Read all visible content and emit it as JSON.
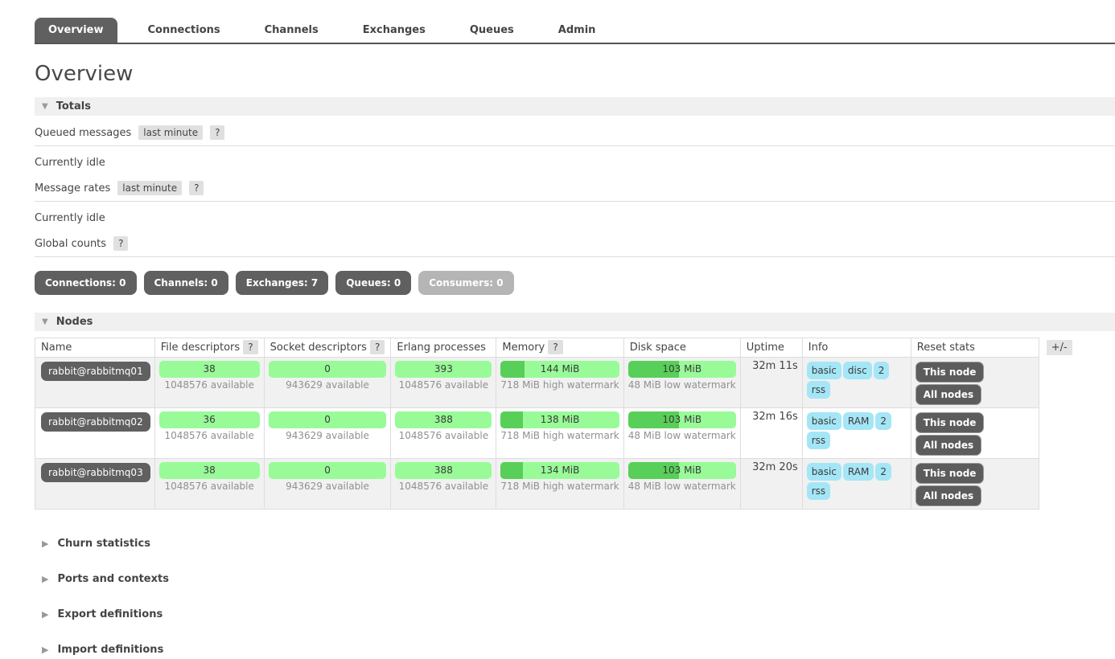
{
  "colors": {
    "accent_dark": "#606060",
    "disabled_gray": "#b5b5b5",
    "bar_light_green": "#98fb98",
    "bar_dark_green": "#58cf58",
    "info_badge_blue": "#a5e6f6",
    "strip_gray": "#f0f0f0"
  },
  "nav": {
    "tabs": [
      {
        "label": "Overview",
        "active": true
      },
      {
        "label": "Connections",
        "active": false
      },
      {
        "label": "Channels",
        "active": false
      },
      {
        "label": "Exchanges",
        "active": false
      },
      {
        "label": "Queues",
        "active": false
      },
      {
        "label": "Admin",
        "active": false
      }
    ]
  },
  "page_title": "Overview",
  "totals": {
    "section_label": "Totals",
    "queued": {
      "label": "Queued messages",
      "mode": "last minute",
      "help": "?",
      "status": "Currently idle"
    },
    "message_rates": {
      "label": "Message rates",
      "mode": "last minute",
      "help": "?",
      "status": "Currently idle"
    },
    "global_counts": {
      "label": "Global counts",
      "help": "?"
    },
    "counts": [
      {
        "label": "Connections: 0",
        "disabled": false
      },
      {
        "label": "Channels: 0",
        "disabled": false
      },
      {
        "label": "Exchanges: 7",
        "disabled": false
      },
      {
        "label": "Queues: 0",
        "disabled": false
      },
      {
        "label": "Consumers: 0",
        "disabled": true
      }
    ]
  },
  "nodes": {
    "section_label": "Nodes",
    "plus_minus": "+/-",
    "help_badge": "?",
    "columns": [
      "Name",
      "File descriptors",
      "Socket descriptors",
      "Erlang processes",
      "Memory",
      "Disk space",
      "Uptime",
      "Info",
      "Reset stats"
    ],
    "rows": [
      {
        "name": "rabbit@rabbitmq01",
        "fd": {
          "value": "38",
          "sub": "1048576 available",
          "pct": 0
        },
        "sd": {
          "value": "0",
          "sub": "943629 available",
          "pct": 0
        },
        "erlang": {
          "value": "393",
          "sub": "1048576 available",
          "pct": 0
        },
        "memory": {
          "value": "144 MiB",
          "sub": "718 MiB high watermark",
          "pct": 20
        },
        "disk": {
          "value": "103 MiB",
          "sub": "48 MiB low watermark",
          "pct": 47
        },
        "uptime": "32m 11s",
        "info": [
          "basic",
          "disc",
          "2",
          "rss"
        ],
        "reset": [
          "This node",
          "All nodes"
        ]
      },
      {
        "name": "rabbit@rabbitmq02",
        "fd": {
          "value": "36",
          "sub": "1048576 available",
          "pct": 0
        },
        "sd": {
          "value": "0",
          "sub": "943629 available",
          "pct": 0
        },
        "erlang": {
          "value": "388",
          "sub": "1048576 available",
          "pct": 0
        },
        "memory": {
          "value": "138 MiB",
          "sub": "718 MiB high watermark",
          "pct": 19
        },
        "disk": {
          "value": "103 MiB",
          "sub": "48 MiB low watermark",
          "pct": 47
        },
        "uptime": "32m 16s",
        "info": [
          "basic",
          "RAM",
          "2",
          "rss"
        ],
        "reset": [
          "This node",
          "All nodes"
        ]
      },
      {
        "name": "rabbit@rabbitmq03",
        "fd": {
          "value": "38",
          "sub": "1048576 available",
          "pct": 0
        },
        "sd": {
          "value": "0",
          "sub": "943629 available",
          "pct": 0
        },
        "erlang": {
          "value": "388",
          "sub": "1048576 available",
          "pct": 0
        },
        "memory": {
          "value": "134 MiB",
          "sub": "718 MiB high watermark",
          "pct": 19
        },
        "disk": {
          "value": "103 MiB",
          "sub": "48 MiB low watermark",
          "pct": 47
        },
        "uptime": "32m 20s",
        "info": [
          "basic",
          "RAM",
          "2",
          "rss"
        ],
        "reset": [
          "This node",
          "All nodes"
        ]
      }
    ]
  },
  "collapsed_sections": [
    "Churn statistics",
    "Ports and contexts",
    "Export definitions",
    "Import definitions"
  ]
}
